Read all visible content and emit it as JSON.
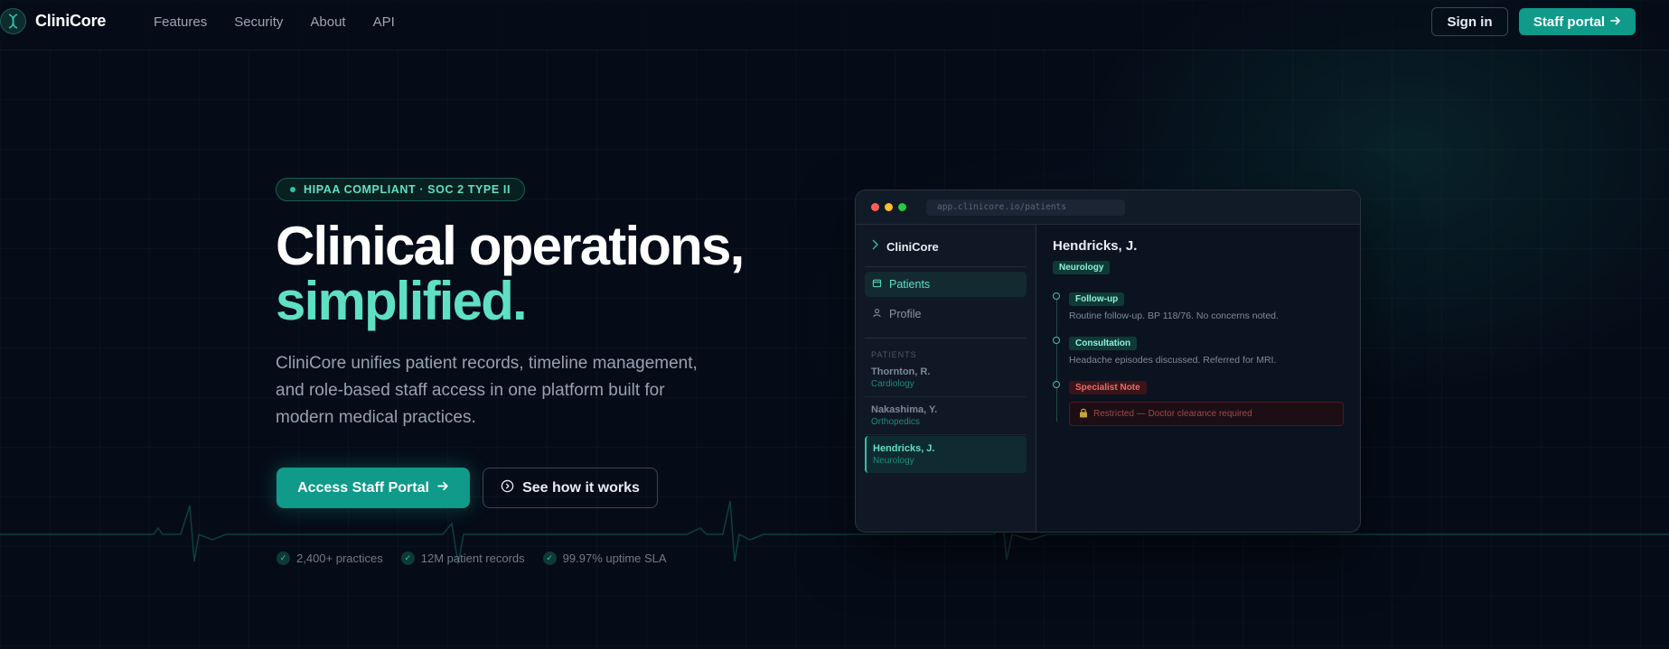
{
  "nav": {
    "brand": "CliniCore",
    "links": [
      "Features",
      "Security",
      "About",
      "API"
    ],
    "sign_in": "Sign in",
    "staff_portal": "Staff portal"
  },
  "hero": {
    "badge": "HIPAA COMPLIANT · SOC 2 TYPE II",
    "title_line1": "Clinical operations,",
    "title_line2": "simplified.",
    "description": "CliniCore unifies patient records, timeline management, and role-based staff access in one platform built for modern medical practices.",
    "primary_cta": "Access Staff Portal",
    "secondary_cta": "See how it works",
    "stats": [
      "2,400+ practices",
      "12M patient records",
      "99.97% uptime SLA"
    ]
  },
  "app": {
    "url": "app.clinicore.io/patients",
    "brand": "CliniCore",
    "nav": [
      "Patients",
      "Profile"
    ],
    "section_label": "PATIENTS",
    "patients": [
      {
        "name": "Thornton, R.",
        "dept": "Cardiology"
      },
      {
        "name": "Nakashima, Y.",
        "dept": "Orthopedics"
      },
      {
        "name": "Hendricks, J.",
        "dept": "Neurology"
      }
    ],
    "selected": {
      "name": "Hendricks, J.",
      "dept": "Neurology",
      "timeline": [
        {
          "tag": "Follow-up",
          "text": "Routine follow-up. BP 118/76. No concerns noted."
        },
        {
          "tag": "Consultation",
          "text": "Headache episodes discussed. Referred for MRI."
        },
        {
          "tag": "Specialist Note",
          "text": ""
        }
      ],
      "restricted": "Restricted — Doctor clearance required"
    }
  },
  "colors": {
    "accent": "#0f9a8a",
    "accent_light": "#5fe0c5",
    "background": "#050c18",
    "restricted_red": "#e56d6d"
  },
  "icons": {
    "brand": "dna-icon",
    "arrow": "arrow-right-icon",
    "play": "play-circle-icon",
    "check": "check-icon",
    "calendar": "calendar-icon",
    "user": "user-icon",
    "lock": "lock-icon"
  }
}
